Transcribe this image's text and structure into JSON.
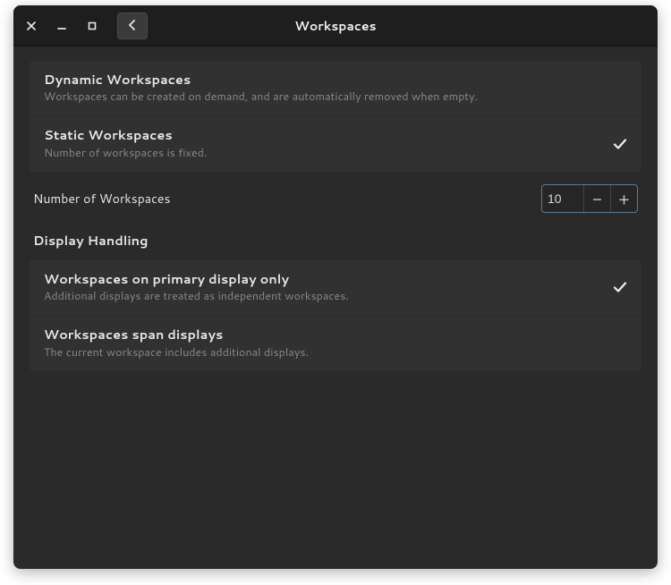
{
  "header": {
    "title": "Workspaces"
  },
  "workspace_mode": {
    "options": [
      {
        "title": "Dynamic Workspaces",
        "subtitle": "Workspaces can be created on demand, and are automatically removed when empty.",
        "selected": false
      },
      {
        "title": "Static Workspaces",
        "subtitle": "Number of workspaces is fixed.",
        "selected": true
      }
    ]
  },
  "number_row": {
    "label": "Number of Workspaces",
    "value": "10",
    "minus": "−",
    "plus": "+"
  },
  "display_handling": {
    "heading": "Display Handling",
    "options": [
      {
        "title": "Workspaces on primary display only",
        "subtitle": "Additional displays are treated as independent workspaces.",
        "selected": true
      },
      {
        "title": "Workspaces span displays",
        "subtitle": "The current workspace includes additional displays.",
        "selected": false
      }
    ]
  }
}
